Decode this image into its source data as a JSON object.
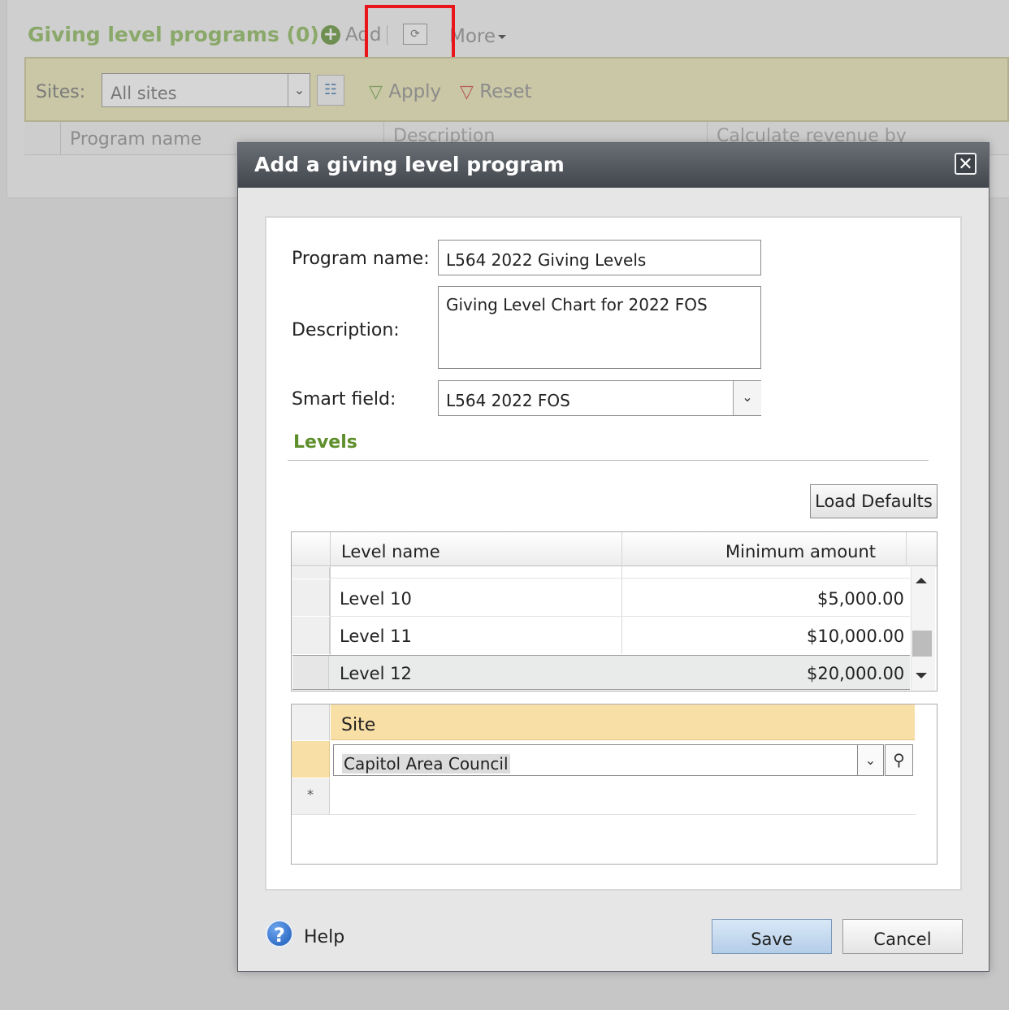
{
  "background": {
    "page_title": "Giving level programs (0)",
    "toolbar": {
      "add_label": "Add",
      "refresh_icon": "refresh-icon",
      "more_label": "More"
    },
    "filter": {
      "sites_label": "Sites:",
      "sites_value": "All sites",
      "apply_label": "Apply",
      "reset_label": "Reset"
    },
    "columns": [
      "Program name",
      "Description",
      "Calculate revenue by"
    ]
  },
  "dialog": {
    "title": "Add a giving level program",
    "close_icon": "close-icon",
    "form": {
      "program_name_label": "Program name:",
      "program_name_value": "L564 2022 Giving Levels",
      "description_label": "Description:",
      "description_value": "Giving Level Chart for 2022 FOS",
      "smart_field_label": "Smart field:",
      "smart_field_value": "L564 2022 FOS"
    },
    "levels": {
      "heading": "Levels",
      "load_defaults_label": "Load Defaults",
      "columns": {
        "level_name": "Level name",
        "minimum_amount": "Minimum amount"
      },
      "rows": [
        {
          "level_name": "Level 10",
          "minimum_amount": "$5,000.00"
        },
        {
          "level_name": "Level 11",
          "minimum_amount": "$10,000.00"
        },
        {
          "level_name": "Level 12",
          "minimum_amount": "$20,000.00"
        }
      ]
    },
    "sites": {
      "column_header": "Site",
      "rows": [
        {
          "site": "Capitol Area Council"
        }
      ],
      "new_row_marker": "*"
    },
    "footer": {
      "help_label": "Help",
      "save_label": "Save",
      "cancel_label": "Cancel"
    }
  },
  "colors": {
    "overlay_gray": "#c6c6c6",
    "title_bar": "#4a4f55",
    "levels_heading": "#5f8f2c",
    "site_header": "#f8dfa6",
    "highlight_box": "#e8161c"
  }
}
